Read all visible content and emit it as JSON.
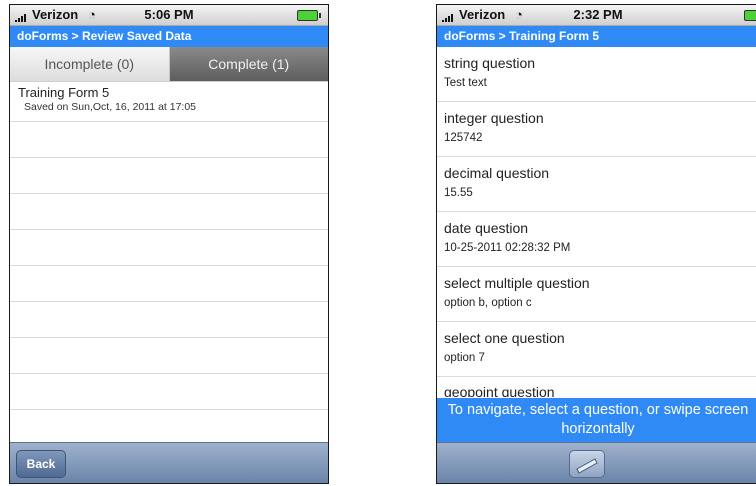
{
  "left_screen": {
    "status": {
      "carrier": "Verizon",
      "time": "5:06 PM"
    },
    "title": "doForms > Review Saved Data",
    "tabs": [
      {
        "label": "Incomplete (0)"
      },
      {
        "label": "Complete (1)"
      }
    ],
    "items": [
      {
        "title": "Training Form 5",
        "subtitle": "Saved on Sun,Oct, 16, 2011 at 17:05"
      }
    ],
    "back_label": "Back"
  },
  "right_screen": {
    "status": {
      "carrier": "Verizon",
      "time": "2:32 PM"
    },
    "title": "doForms > Training Form 5",
    "questions": [
      {
        "label": "string question",
        "value": "Test text"
      },
      {
        "label": "integer question",
        "value": "125742"
      },
      {
        "label": "decimal question",
        "value": "15.55"
      },
      {
        "label": "date question",
        "value": "10-25-2011 02:28:32 PM"
      },
      {
        "label": "select multiple question",
        "value": "option b, option c"
      },
      {
        "label": "select one question",
        "value": "option 7"
      },
      {
        "label": "geopoint question",
        "value": ""
      }
    ],
    "hint": "To navigate, select a question, or swipe screen horizontally",
    "icons": {
      "wifi": "wifi-icon",
      "battery": "battery-icon",
      "signal": "signal-icon",
      "navigate": "swipe-navigate-icon"
    }
  }
}
